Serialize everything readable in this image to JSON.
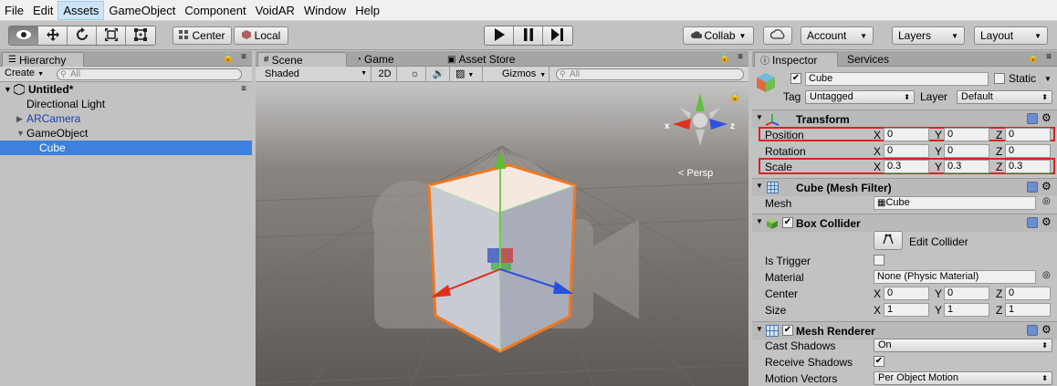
{
  "menu": [
    "File",
    "Edit",
    "Assets",
    "GameObject",
    "Component",
    "VoidAR",
    "Window",
    "Help"
  ],
  "menu_active": "Assets",
  "toolbar": {
    "pivot_label": "Center",
    "space_label": "Local",
    "collab_label": "Collab",
    "account_label": "Account",
    "layers_label": "Layers",
    "layout_label": "Layout"
  },
  "hierarchy": {
    "tab": "Hierarchy",
    "create_label": "Create",
    "search_placeholder": "All",
    "scene_name": "Untitled*",
    "items": [
      {
        "label": "Directional Light"
      },
      {
        "label": "ARCamera"
      },
      {
        "label": "GameObject"
      },
      {
        "label": "Cube"
      }
    ]
  },
  "scene": {
    "tabs": [
      "Scene",
      "Game",
      "Asset Store"
    ],
    "shading": "Shaded",
    "mode_2d": "2D",
    "gizmos_label": "Gizmos",
    "search_placeholder": "All",
    "persp_label": "Persp",
    "axis_x": "x",
    "axis_z": "z"
  },
  "inspector": {
    "tabs": [
      "Inspector",
      "Services"
    ],
    "object_name": "Cube",
    "static_label": "Static",
    "tag_label": "Tag",
    "tag_value": "Untagged",
    "layer_label": "Layer",
    "layer_value": "Default",
    "transform": {
      "title": "Transform",
      "position": {
        "label": "Position",
        "x": "0",
        "y": "0",
        "z": "0"
      },
      "rotation": {
        "label": "Rotation",
        "x": "0",
        "y": "0",
        "z": "0"
      },
      "scale": {
        "label": "Scale",
        "x": "0.3",
        "y": "0.3",
        "z": "0.3"
      }
    },
    "mesh_filter": {
      "title": "Cube (Mesh Filter)",
      "mesh_label": "Mesh",
      "mesh_value": "Cube"
    },
    "box_collider": {
      "title": "Box Collider",
      "edit_label": "Edit Collider",
      "is_trigger_label": "Is Trigger",
      "material_label": "Material",
      "material_value": "None (Physic Material)",
      "center": {
        "label": "Center",
        "x": "0",
        "y": "0",
        "z": "0"
      },
      "size": {
        "label": "Size",
        "x": "1",
        "y": "1",
        "z": "1"
      }
    },
    "mesh_renderer": {
      "title": "Mesh Renderer",
      "cast_label": "Cast Shadows",
      "cast_value": "On",
      "receive_label": "Receive Shadows",
      "motion_label": "Motion Vectors",
      "motion_value": "Per Object Motion"
    }
  },
  "axis_letters": {
    "x": "X",
    "y": "Y",
    "z": "Z"
  },
  "colors": {
    "selection": "#3d80df",
    "highlight_red": "#e02020",
    "cube_outline": "#f07820"
  }
}
